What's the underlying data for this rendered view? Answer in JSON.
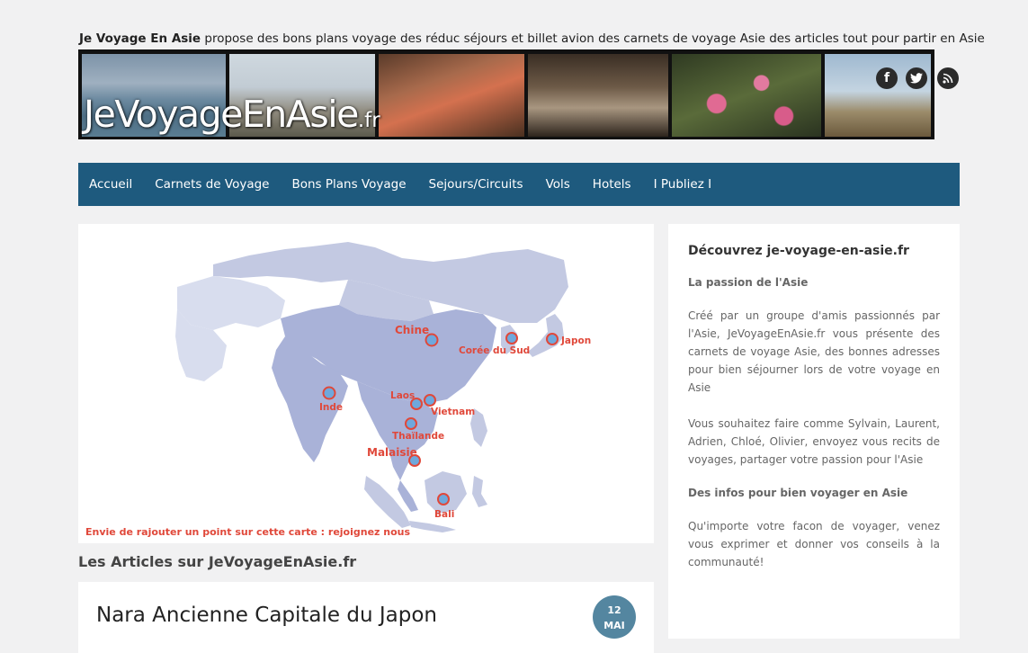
{
  "header": {
    "tagline_brand": "Je Voyage En Asie",
    "tagline_text": " propose des bons plans voyage des réduc séjours et billet avion des carnets de voyage Asie des articles tout pour partir en Asie",
    "logo_main": "JeVoyageEnAsie",
    "logo_suffix": ".fr",
    "social": {
      "facebook": "f",
      "twitter": "t",
      "rss": "rss"
    }
  },
  "nav": {
    "items": [
      "Accueil",
      "Carnets de Voyage",
      "Bons Plans Voyage",
      "Sejours/Circuits",
      "Vols",
      "Hotels",
      "I Publiez I"
    ]
  },
  "map": {
    "labels": {
      "chine": "Chine",
      "coree": "Corée du Sud",
      "japon": "Japon",
      "inde": "Inde",
      "laos": "Laos",
      "vietnam": "Vietnam",
      "thailande": "Thaïlande",
      "malaisie": "Malaisie",
      "bali": "Bali"
    },
    "note": "Envie de rajouter un point sur cette carte : rejoignez nous"
  },
  "articles": {
    "section_title": "Les Articles sur JeVoyageEnAsie.fr",
    "first": {
      "title": "Nara Ancienne Capitale du Japon",
      "day": "12",
      "month": "MAI"
    }
  },
  "sidebar": {
    "title": "Découvrez je-voyage-en-asie.fr",
    "h1": "La passion de l'Asie",
    "p1": "Créé par un groupe d'amis passionnés par l'Asie, JeVoyageEnAsie.fr vous présente des carnets de voyage Asie, des bonnes adresses pour bien séjourner lors de votre voyage en Asie",
    "p2": "Vous souhaitez faire comme Sylvain, Laurent, Adrien, Chloé, Olivier, envoyez vous recits de voyages, partager votre passion pour l'Asie",
    "h2": "Des infos pour bien voyager en Asie",
    "p3": "Qu'importe votre facon de voyager, venez vous exprimer et donner vos conseils à la communauté!"
  },
  "colors": {
    "nav_bg": "#1e5a7e",
    "map_label": "#e0483a",
    "badge": "#5486a0"
  }
}
